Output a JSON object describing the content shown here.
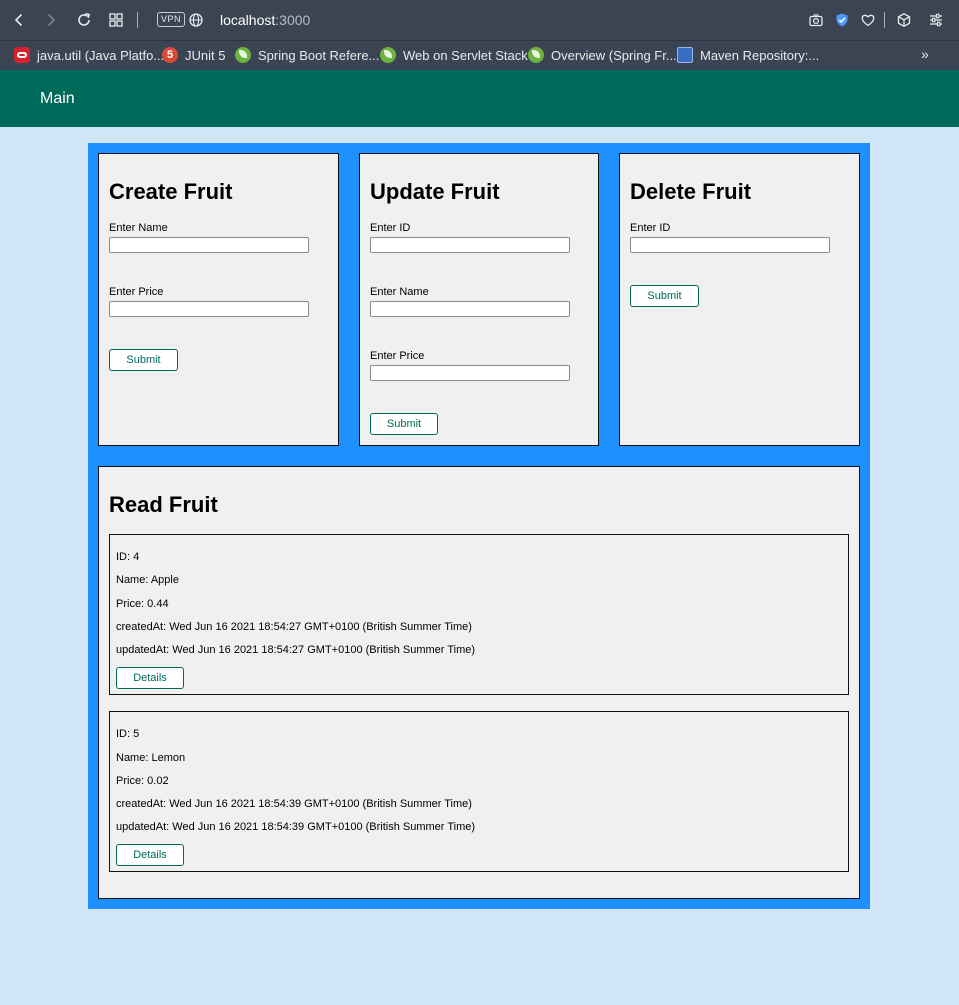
{
  "browser": {
    "url_host": "localhost",
    "url_port": ":3000",
    "vpn_label": "VPN",
    "bookmarks": [
      {
        "label": "java.util (Java Platfo...",
        "icon": "oracle-icon"
      },
      {
        "label": "JUnit 5",
        "icon": "junit-icon",
        "icon_text": "5"
      },
      {
        "label": "Spring Boot Refere...",
        "icon": "spring-icon"
      },
      {
        "label": "Web on Servlet Stack",
        "icon": "spring-icon"
      },
      {
        "label": "Overview (Spring Fr...",
        "icon": "spring-icon"
      },
      {
        "label": "Maven Repository:...",
        "icon": "maven-icon"
      }
    ],
    "more_label": "»"
  },
  "nav": {
    "main_link": "Main",
    "background": "#006a5a"
  },
  "create": {
    "title": "Create Fruit",
    "name_label": "Enter Name",
    "name_value": "",
    "price_label": "Enter Price",
    "price_value": "",
    "submit": "Submit"
  },
  "update": {
    "title": "Update Fruit",
    "id_label": "Enter ID",
    "id_value": "",
    "name_label": "Enter Name",
    "name_value": "",
    "price_label": "Enter Price",
    "price_value": "",
    "submit": "Submit"
  },
  "delete": {
    "title": "Delete Fruit",
    "id_label": "Enter ID",
    "id_value": "",
    "submit": "Submit"
  },
  "read": {
    "title": "Read Fruit",
    "fruits": [
      {
        "id": "ID: 4",
        "name": "Name: Apple",
        "price": "Price: 0.44",
        "created": "createdAt: Wed Jun 16 2021 18:54:27 GMT+0100 (British Summer Time)",
        "updated": "updatedAt: Wed Jun 16 2021 18:54:27 GMT+0100 (British Summer Time)",
        "details": "Details"
      },
      {
        "id": "ID: 5",
        "name": "Name: Lemon",
        "price": "Price: 0.02",
        "created": "createdAt: Wed Jun 16 2021 18:54:39 GMT+0100 (British Summer Time)",
        "updated": "updatedAt: Wed Jun 16 2021 18:54:39 GMT+0100 (British Summer Time)",
        "details": "Details"
      }
    ]
  },
  "colors": {
    "page_bg": "#d1e5f8",
    "container_bg": "#1e90ff",
    "card_bg": "#f0f0f0",
    "accent": "#006a5a"
  }
}
